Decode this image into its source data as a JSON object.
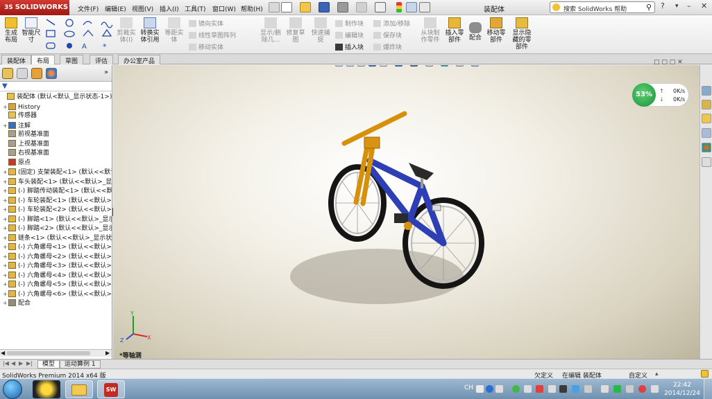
{
  "app": {
    "logo": "SOLIDWORKS",
    "title": "装配体",
    "search_placeholder": "搜索 SolidWorks 帮助"
  },
  "menu": [
    "文件(F)",
    "编辑(E)",
    "视图(V)",
    "插入(I)",
    "工具(T)",
    "窗口(W)",
    "帮助(H)"
  ],
  "ribbon": {
    "sketch": [
      "生成布局",
      "智能尺寸"
    ],
    "cut_solid": "剪裁实体(I)",
    "convert": "转换实体引用",
    "offset": "等距实体",
    "mirror": "镜向实体",
    "linear_pattern": "线性草图阵列",
    "move": "移动实体",
    "show_hide": "显示/删除几...",
    "repair": "修复草图",
    "quick_snap": "快速捕捉",
    "make_block": "制作块",
    "edit_block": "编辑块",
    "insert_block": "插入块",
    "add_remove": "添加/移除",
    "save_block": "保存块",
    "explode_block": "爆炸块",
    "from_block": "从块制作零件",
    "insert_part": "插入零部件",
    "mate": "配合",
    "move_part": "移动零部件",
    "show_hidden": "显示隐藏的零部件"
  },
  "tabs": [
    "装配体",
    "布局",
    "草图",
    "评估",
    "办公室产品"
  ],
  "active_tab": "布局",
  "tree": [
    {
      "label": "装配体 (默认<默认_显示状态-1>)",
      "level": 0,
      "expander": ""
    },
    {
      "label": "History",
      "level": 1,
      "expander": "+"
    },
    {
      "label": "传感器",
      "level": 1,
      "expander": ""
    },
    {
      "label": "注解",
      "level": 1,
      "expander": "+"
    },
    {
      "label": "前视基准面",
      "level": 1,
      "expander": ""
    },
    {
      "label": "上视基准面",
      "level": 1,
      "expander": ""
    },
    {
      "label": "右视基准面",
      "level": 1,
      "expander": ""
    },
    {
      "label": "原点",
      "level": 1,
      "expander": ""
    },
    {
      "label": "(固定) 支架装配<1> (默认<<默认",
      "level": 1,
      "expander": "+"
    },
    {
      "label": "车头装配<1> (默认<<默认>_显",
      "level": 1,
      "expander": "+"
    },
    {
      "label": "(-) 脚踏传动装配<1> (默认<<默",
      "level": 1,
      "expander": "+"
    },
    {
      "label": "(-) 车轮装配<1> (默认<<默认>",
      "level": 1,
      "expander": "+"
    },
    {
      "label": "(-) 车轮装配<2> (默认<<默认>",
      "level": 1,
      "expander": "+"
    },
    {
      "label": "(-) 脚踏<1> (默认<<默认>_显示",
      "level": 1,
      "expander": "+"
    },
    {
      "label": "(-) 脚踏<2> (默认<<默认>_显示",
      "level": 1,
      "expander": "+"
    },
    {
      "label": "链条<1> (默认<<默认>_显示状态",
      "level": 1,
      "expander": "+"
    },
    {
      "label": "(-) 六角螺母<1> (默认<<默认>",
      "level": 1,
      "expander": "+"
    },
    {
      "label": "(-) 六角螺母<2> (默认<<默认>",
      "level": 1,
      "expander": "+"
    },
    {
      "label": "(-) 六角螺母<3> (默认<<默认>",
      "level": 1,
      "expander": "+"
    },
    {
      "label": "(-) 六角螺母<4> (默认<<默认>",
      "level": 1,
      "expander": "+"
    },
    {
      "label": "(-) 六角螺母<5> (默认<<默认>",
      "level": 1,
      "expander": "+"
    },
    {
      "label": "(-) 六角螺母<6> (默认<<默认>",
      "level": 1,
      "expander": "+"
    },
    {
      "label": "配合",
      "level": 1,
      "expander": "+"
    }
  ],
  "viewport": {
    "view_name": "*等轴测",
    "net_percent": "53%",
    "net_up": "0K/s",
    "net_down": "0K/s"
  },
  "bottom_tabs": [
    "模型",
    "运动算例 1"
  ],
  "status": {
    "version": "SolidWorks Premium 2014 x64 版",
    "defined": "欠定义",
    "editing": "在编辑 装配体",
    "custom": "自定义"
  },
  "clock": {
    "time": "22:42",
    "date": "2014/12/24"
  },
  "tray": {
    "lang": "CH"
  },
  "colors": {
    "frame": "#2e3fb5",
    "fork": "#d6900a",
    "brand_red": "#c32b22"
  }
}
